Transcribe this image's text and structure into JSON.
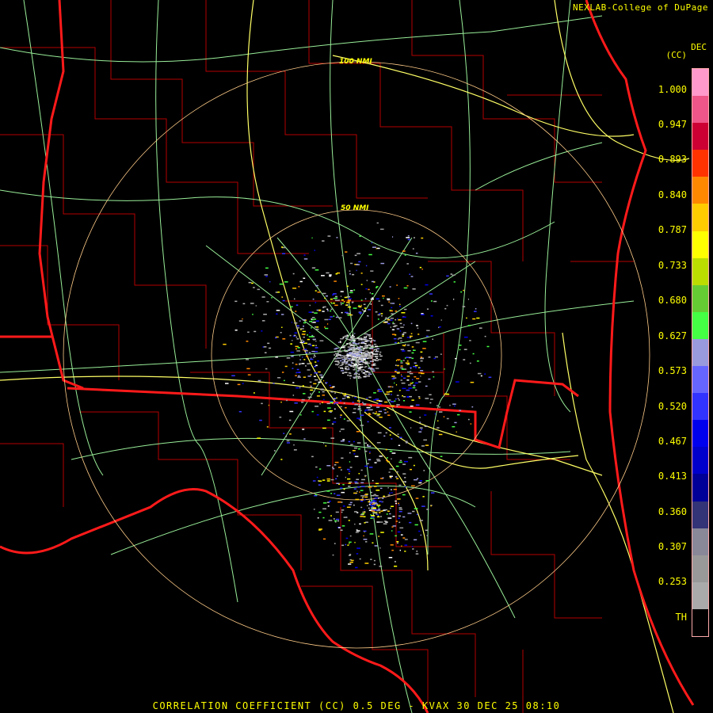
{
  "credit": "NEXLAB-College of DuPage",
  "colorbar": {
    "title_line1": "DEC",
    "title_line2": "(CC)",
    "labels": [
      "1.000",
      "0.947",
      "0.893",
      "0.840",
      "0.787",
      "0.733",
      "0.680",
      "0.627",
      "0.573",
      "0.520",
      "0.467",
      "0.413",
      "0.360",
      "0.307",
      "0.253",
      "TH"
    ],
    "colors": [
      "#ff99cc",
      "#ee5588",
      "#cc0033",
      "#ff3300",
      "#ff8800",
      "#ffcc00",
      "#ffff00",
      "#bbdd00",
      "#66cc33",
      "#44ff44",
      "#9999dd",
      "#6666ff",
      "#3333ff",
      "#0000ee",
      "#0000cc",
      "#000099",
      "#333377",
      "#888899",
      "#999999",
      "#aaaaaa",
      "#000000"
    ]
  },
  "range_rings": [
    {
      "label": "50 NMI"
    },
    {
      "label": "100 NMI"
    }
  ],
  "caption": "CORRELATION COEFFICIENT (CC) 0.5 DEG - KVAX 30 DEC 25 08:10",
  "colors": {
    "state_border": "#ff1a1a",
    "county_border": "#b30000",
    "roads_major": "#ffff66",
    "roads_minor": "#99ee99",
    "range_ring": "#ffcc88",
    "text": "#ffff00"
  }
}
